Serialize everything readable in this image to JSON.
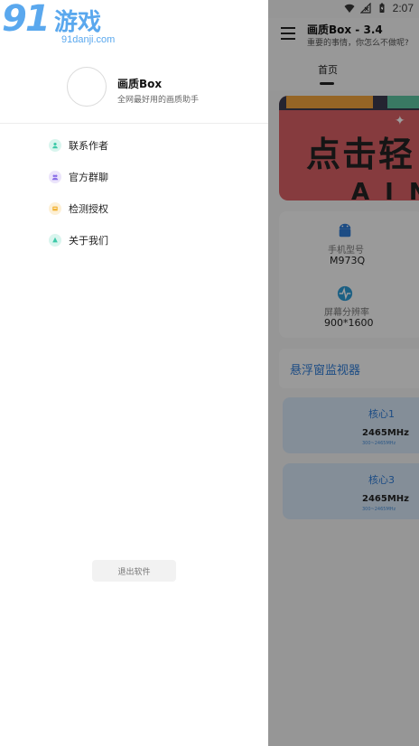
{
  "status_bar": {
    "time": "2:07"
  },
  "watermark": {
    "brand_number": "91",
    "brand_cn": "游戏",
    "domain": "91danji.com"
  },
  "app": {
    "title": "画质Box - 3.4",
    "subtitle": "重要的事情，你怎么不做呢?",
    "tab_home": "首页",
    "banner": {
      "headline": "点击轻",
      "sub": "A I N"
    },
    "device_info": [
      {
        "icon": "android-icon",
        "label": "手机型号",
        "value": "M973Q"
      },
      {
        "icon": "pulse-icon",
        "label": "屏幕分辨率",
        "value": "900*1600"
      }
    ],
    "float_monitor_label": "悬浮窗监视器",
    "cores": [
      {
        "name": "核心1",
        "freq": "2465MHz",
        "range": "300~2465MHz"
      },
      {
        "name": "核心3",
        "freq": "2465MHz",
        "range": "300~2465MHz"
      }
    ]
  },
  "drawer": {
    "profile_name": "画质Box",
    "profile_desc": "全网最好用的画质助手",
    "menu": [
      {
        "label": "联系作者",
        "icon": "person-icon",
        "color": "#3cc9a8"
      },
      {
        "label": "官方群聊",
        "icon": "group-icon",
        "color": "#8a6ee8"
      },
      {
        "label": "检测授权",
        "icon": "key-icon",
        "color": "#f2b53a"
      },
      {
        "label": "关于我们",
        "icon": "info-icon",
        "color": "#3cc9a8"
      }
    ],
    "exit_label": "退出软件"
  },
  "colors": {
    "accent_blue": "#2e7bd6",
    "scrim": "rgba(0,0,0,0.38)"
  }
}
